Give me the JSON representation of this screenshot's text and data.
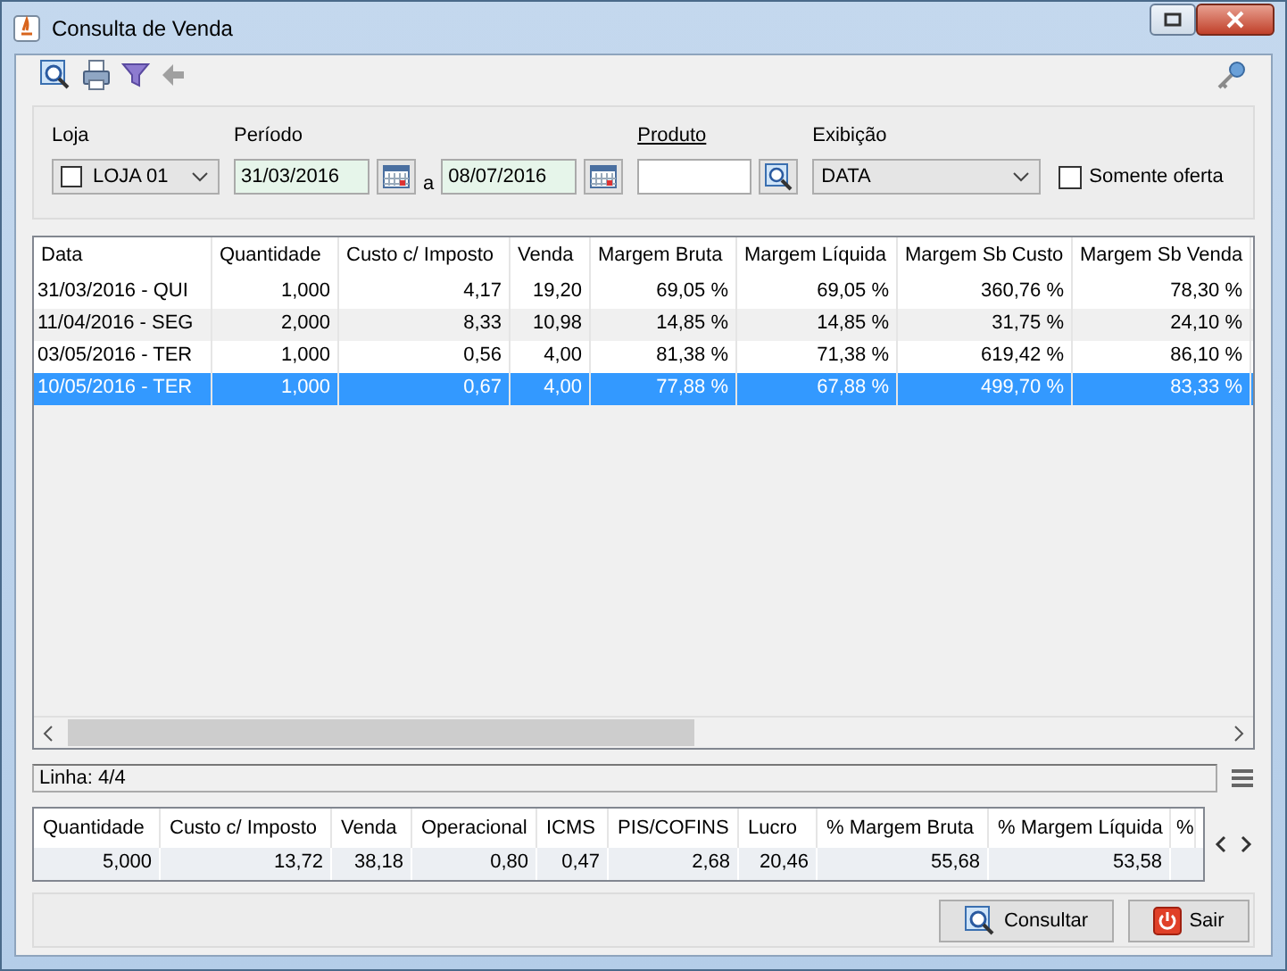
{
  "window": {
    "title": "Consulta de Venda"
  },
  "filters": {
    "loja": {
      "label": "Loja",
      "checked": false,
      "value": "LOJA 01"
    },
    "periodo": {
      "label": "Período",
      "from": "31/03/2016",
      "separator": "a",
      "to": "08/07/2016"
    },
    "produto": {
      "label": "Produto"
    },
    "exibicao": {
      "label": "Exibição",
      "value": "DATA"
    },
    "somente_oferta": {
      "label": "Somente oferta",
      "checked": false
    }
  },
  "table": {
    "columns": [
      "Data",
      "Quantidade",
      "Custo c/ Imposto",
      "Venda",
      "Margem Bruta",
      "Margem Líquida",
      "Margem Sb Custo",
      "Margem Sb Venda"
    ],
    "rows": [
      {
        "selected": false,
        "cells": [
          "31/03/2016 - QUI",
          "1,000",
          "4,17",
          "19,20",
          "69,05 %",
          "69,05 %",
          "360,76 %",
          "78,30 %"
        ]
      },
      {
        "selected": false,
        "cells": [
          "11/04/2016 - SEG",
          "2,000",
          "8,33",
          "10,98",
          "14,85 %",
          "14,85 %",
          "31,75 %",
          "24,10 %"
        ]
      },
      {
        "selected": false,
        "cells": [
          "03/05/2016 - TER",
          "1,000",
          "0,56",
          "4,00",
          "81,38 %",
          "71,38 %",
          "619,42 %",
          "86,10 %"
        ]
      },
      {
        "selected": true,
        "cells": [
          "10/05/2016 - TER",
          "1,000",
          "0,67",
          "4,00",
          "77,88 %",
          "67,88 %",
          "499,70 %",
          "83,33 %"
        ]
      }
    ]
  },
  "status": {
    "text": "Linha: 4/4"
  },
  "totals": {
    "columns": [
      "Quantidade",
      "Custo c/ Imposto",
      "Venda",
      "Operacional",
      "ICMS",
      "PIS/COFINS",
      "Lucro",
      "% Margem Bruta",
      "% Margem Líquida",
      "%"
    ],
    "values": [
      "5,000",
      "13,72",
      "38,18",
      "0,80",
      "0,47",
      "2,68",
      "20,46",
      "55,68",
      "53,58"
    ]
  },
  "buttons": [
    {
      "kind": "search",
      "label": "Consultar"
    },
    {
      "kind": "exit",
      "label": "Sair"
    }
  ]
}
